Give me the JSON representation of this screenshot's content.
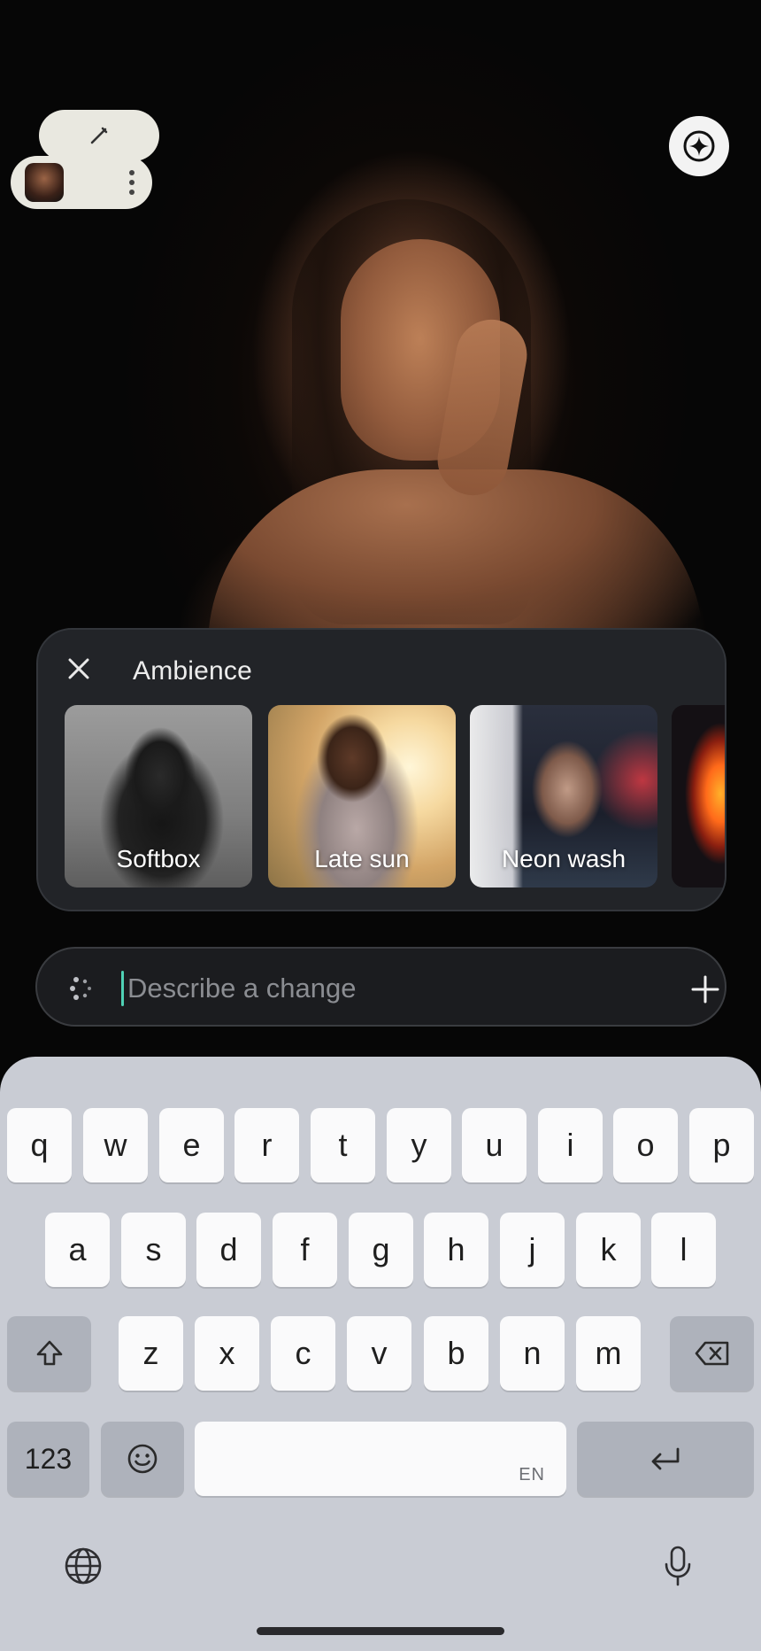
{
  "canvas": {
    "edit_button_icon": "pen-icon",
    "layer_menu_icon": "more-vert-icon",
    "assistant_button_icon": "sparkle-icon"
  },
  "ambience": {
    "title": "Ambience",
    "close_icon": "close-icon",
    "options": [
      {
        "label": "Softbox"
      },
      {
        "label": "Late sun"
      },
      {
        "label": "Neon wash"
      },
      {
        "label": ""
      }
    ]
  },
  "prompt": {
    "placeholder": "Describe a change",
    "value": "",
    "leading_icon": "dots-loader-icon",
    "add_icon": "plus-icon"
  },
  "keyboard": {
    "row1": [
      "q",
      "w",
      "e",
      "r",
      "t",
      "y",
      "u",
      "i",
      "o",
      "p"
    ],
    "row2": [
      "a",
      "s",
      "d",
      "f",
      "g",
      "h",
      "j",
      "k",
      "l"
    ],
    "row3": [
      "z",
      "x",
      "c",
      "v",
      "b",
      "n",
      "m"
    ],
    "numbers_label": "123",
    "space_lang": "EN",
    "icons": {
      "shift": "shift-icon",
      "backspace": "backspace-icon",
      "emoji": "emoji-icon",
      "enter": "enter-icon",
      "globe": "globe-icon",
      "mic": "mic-icon"
    },
    "colors": {
      "keyboard_bg": "#c9ccd4",
      "key_bg": "#fafafb",
      "fn_key_bg": "#aeb2bb"
    }
  },
  "colors": {
    "panel_bg": "#222428",
    "caret": "#4fd1b5",
    "prompt_bg": "#1b1c1f"
  }
}
